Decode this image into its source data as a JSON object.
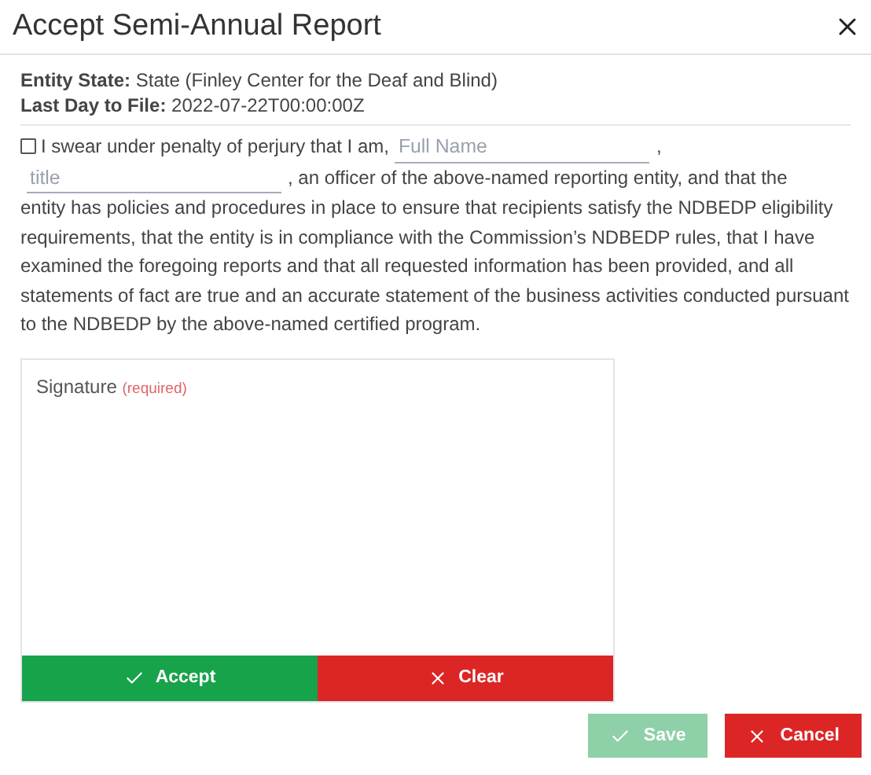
{
  "dialog": {
    "title": "Accept Semi-Annual Report"
  },
  "details": [
    {
      "label": "Entity State:",
      "value": "State (Finley Center for the Deaf and Blind)"
    },
    {
      "label": "Last Day to File:",
      "value": "2022-07-22T00:00:00Z"
    }
  ],
  "oath": {
    "checked": false,
    "lead": "I swear under penalty of perjury that I am,",
    "name_placeholder": "Full Name",
    "comma": ",",
    "title_placeholder": "title",
    "rest_line": ", an officer of the above-named reporting entity, and that the",
    "rest": "entity has policies and procedures in place to ensure that recipients satisfy the NDBEDP eligibility requirements, that the entity is in compliance with the Commission’s NDBEDP rules, that I have examined the foregoing reports and that all requested information has been provided, and all statements of fact are true and an accurate statement of the business activities conducted pursuant to the NDBEDP by the above-named certified program."
  },
  "signature": {
    "label": "Signature",
    "note": "(required)",
    "buttons": [
      {
        "kind": "accept",
        "label": "Accept"
      },
      {
        "kind": "clear",
        "label": "Clear"
      }
    ]
  },
  "footer_buttons": [
    {
      "kind": "save",
      "label": "Save",
      "disabled": true
    },
    {
      "kind": "cancel",
      "label": "Cancel",
      "disabled": false
    }
  ]
}
